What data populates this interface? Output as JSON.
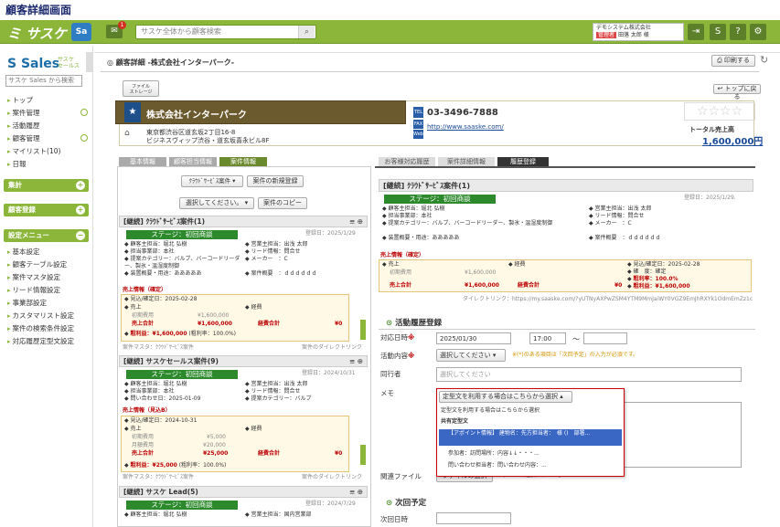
{
  "page_title": "顧客詳細画面",
  "topbar": {
    "logo": "サスケ",
    "sa": "Sa",
    "msg_badge": "1",
    "search_placeholder": "サスケ全体から顧客検索",
    "user_company": "デモシステム株式会社",
    "user_tag": "管理者",
    "user_name": "田落 太郎 様",
    "logout": "Logout"
  },
  "sidebar": {
    "title": "Sales",
    "title_small": "サスケ\nセールス",
    "search_placeholder": "サスケ Sales から検索",
    "items": [
      "トップ",
      "案件管理",
      "活動履歴",
      "顧客管理",
      "マイリスト(10)",
      "日報"
    ],
    "section_aggregate": "集計",
    "section_customer_register": "顧客登録",
    "section_settings": "設定メニュー",
    "settings_items": [
      "基本設定",
      "顧客テーブル設定",
      "案件マスタ設定",
      "リード情報設定",
      "事業部設定",
      "カスタマリスト設定",
      "案件の検索条件設定",
      "対応履歴定型文設定"
    ]
  },
  "breadcrumb": "顧客詳細 -株式会社インターパーク-",
  "print_button": "印刷する",
  "back_top": "トップに戻る",
  "file_storage": "ファイル\nストレージ",
  "company": {
    "name": "株式会社インターパーク",
    "address": "東京都渋谷区道玄坂2丁目16-8",
    "building": "ビジネスヴィップ渋谷・道玄坂喜永ビル8F",
    "tel": "03-3496-7888",
    "url": "http://www.saaske.com/",
    "total_label": "トータル売上高",
    "total_value": "1,600,000円"
  },
  "left_tabs": [
    "基本情報",
    "顧客担当情報",
    "案件情報"
  ],
  "left_panel": {
    "template_select": "ｸﾗｳﾄﾞｻｰﾋﾞｽ案件",
    "new_button": "案件の新規登録",
    "select_placeholder": "選択してください。",
    "copy_button": "案件のコピー"
  },
  "opps": [
    {
      "title": "[継続] ｸﾗｳﾄﾞｻｰﾋﾞｽ案件(1)",
      "date": "登録日：2025/1/29",
      "stage": "ステージ：初回商談",
      "rows": [
        "顧客主担当：堀北 弘樹",
        "営業主担当：出浅 太郎",
        "担当事業部：本社",
        "リード情報：問合せ",
        "提案カテゴリー：バルブ、バーコードリーダー、製氷・温湿度制御",
        "メーカー　：C",
        "装置概要・用途：あああああ",
        "案件概要　：ｄｄｄｄｄｄ"
      ],
      "sales_title": "売上情報（確定）",
      "plan_date": "見込/確定日：2025-02-28",
      "uri": "売上",
      "cost": "経費",
      "cost_label": "初期費用",
      "cost_value": "¥1,600,000",
      "total_label": "売上合計",
      "total_value": "¥1,600,000",
      "cost_total": "経費合計",
      "cost_total_value": "¥0",
      "profit": "粗利益：¥1,600,000",
      "profit_rate": "(粗利率：100.0%)",
      "footer_left": "案件マスタ：ｸﾗｳﾄﾞｻｰﾋﾞｽ案件",
      "footer_right": "案件のダイレクトリンク"
    },
    {
      "title": "[継続] サスケセールス案件(9)",
      "date": "登録日：2024/10/31",
      "stage": "ステージ：初回商談",
      "rows": [
        "顧客主担当：堀北 弘樹",
        "営業主担当：出浅 太郎",
        "担当事業部：本社",
        "リード情報：問合せ",
        "問い合わせ日：2025-01-09",
        "提案カテゴリー：バルブ"
      ],
      "sales_title": "売上情報（見込B）",
      "plan_date": "見込/確定日：2024-10-31",
      "uri": "売上",
      "cost": "経費",
      "cost_label": "初期費用",
      "cost_value": "¥5,000",
      "cost2_label": "月額費用",
      "cost2_value": "¥20,000",
      "total_label": "売上合計",
      "total_value": "¥25,000",
      "cost_total": "経費合計",
      "cost_total_value": "¥0",
      "profit": "粗利益：¥25,000",
      "profit_rate": "(粗利率：100.0%)",
      "footer_left": "案件マスタ：ｸﾗｳﾄﾞｻｰﾋﾞｽ案件",
      "footer_right": "案件のダイレクトリンク"
    },
    {
      "title": "[継続] サスケ Lead(5)",
      "date": "登録日：2024/7/29",
      "stage": "ステージ：初回商談",
      "rows": [
        "顧客主担当：堀北 弘樹",
        "営業主担当：国内営業部"
      ]
    }
  ],
  "right_tabs": [
    "お客様対応履歴",
    "案件詳細情報",
    "履歴登録"
  ],
  "right_opp": {
    "title": "[継続] ｸﾗｳﾄﾞｻｰﾋﾞｽ案件(1)",
    "date": "登録日：2025/1/29.",
    "stage": "ステージ：初回商談",
    "rows": [
      "顧客主担当：堀北 弘樹",
      "営業主担当：出浅 太郎",
      "担当事業部：本社",
      "リード情報：問合せ",
      "提案カテゴリー：バルブ、バーコードリーダー、製氷・温湿度制御",
      "メーカー　：C",
      "装置概要・用途：あああああ",
      "案件概要　：ｄｄｄｄｄｄ"
    ],
    "sales_title": "売上情報（確定）",
    "uri": "売上",
    "cost_label": "初期費用",
    "cost_value": "¥1,600,000",
    "total_label": "売上合計",
    "total_value": "¥1,600,000",
    "cost": "経費",
    "cost_total": "経費合計",
    "cost_total_value": "¥0",
    "plan_date": "見込/確定日：2025-02-28",
    "kakudo": "確　度：確定",
    "rate": "粗利率：100.0%",
    "profit": "粗利益：¥1,600,000",
    "direct": "ダイレクトリンク：https://my.saaske.com/?yUTNyAXPwZSM4YTM9MmJaiWY0VGZ9EmJhRXYk1OdmEmZz1c"
  },
  "activity": {
    "heading": "活動履歴登録",
    "date_label": "対応日時",
    "date": "2025/01/30",
    "time": "17:00",
    "tilde": "～",
    "content_label": "活動内容",
    "content_select": "選択してください",
    "content_note": "※(*)のある項目は「次回予定」の入力が必須です。",
    "staff_label": "同行者",
    "staff_placeholder": "選択してください",
    "memo_label": "メモ",
    "memo_select": "定型文を利用する場合はこちらから選択",
    "file_label": "関連ファイル",
    "file_button": "ファイルの選択",
    "file_text": "ファイルが選択されていません",
    "next_heading": "次回予定",
    "next_date_label": "次回日時"
  },
  "dropdown": {
    "items": [
      "定型文を利用する場合はこちらから選択",
      "共有定型文",
      "【アポイント情報】 建物名：先方担当者：　様 ()　部署...",
      "参加者：訪問場所：内容↓↓・・・...",
      "問い合わせ担当者：問い合わせ内容：..."
    ]
  }
}
